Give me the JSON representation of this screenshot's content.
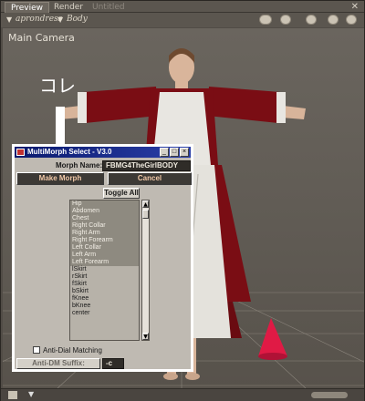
{
  "tabs": [
    {
      "label": "Preview"
    },
    {
      "label": "Render"
    },
    {
      "label": "Untitled"
    }
  ],
  "window": {
    "close_glyph": "✕"
  },
  "toolbar": {
    "figure": "aprondress",
    "part": "Body"
  },
  "viewport": {
    "camera_label": "Main Camera",
    "annotation": "コレ"
  },
  "dialog": {
    "title": "MultiMorph Select - V3.0",
    "title_visible_left": "Multi",
    "title_visible_right": "Select - V3.0",
    "morph_name_label": "Morph Name:",
    "morph_name_value": "FBMG4TheGirlBODY",
    "make_morph_label": "Make Morph",
    "cancel_label": "Cancel",
    "toggle_all_label": "Toggle All",
    "list_items": [
      {
        "label": "Hip",
        "selected": true
      },
      {
        "label": "Abdomen",
        "selected": true
      },
      {
        "label": "Chest",
        "selected": true
      },
      {
        "label": "Right Collar",
        "selected": true
      },
      {
        "label": "Right Arm",
        "selected": true
      },
      {
        "label": "Right Forearm",
        "selected": true
      },
      {
        "label": "Left Collar",
        "selected": true
      },
      {
        "label": "Left Arm",
        "selected": true
      },
      {
        "label": "Left Forearm",
        "selected": true
      },
      {
        "label": "lSkirt",
        "selected": false
      },
      {
        "label": "rSkirt",
        "selected": false
      },
      {
        "label": "fSkirt",
        "selected": false
      },
      {
        "label": "bSkirt",
        "selected": false
      },
      {
        "label": "fKnee",
        "selected": false
      },
      {
        "label": "bKnee",
        "selected": false
      },
      {
        "label": "center",
        "selected": false
      }
    ],
    "anti_dial_label": "Anti-Dial Matching",
    "anti_dial_checked": false,
    "anti_dm_suffix_label": "Anti-DM Suffix:",
    "anti_dm_suffix_value": "-c"
  },
  "colors": {
    "title_bar": "#0a1a6e",
    "dress": "#7a0d14",
    "apron": "#e8e6e1",
    "cone": "#e01a45"
  }
}
